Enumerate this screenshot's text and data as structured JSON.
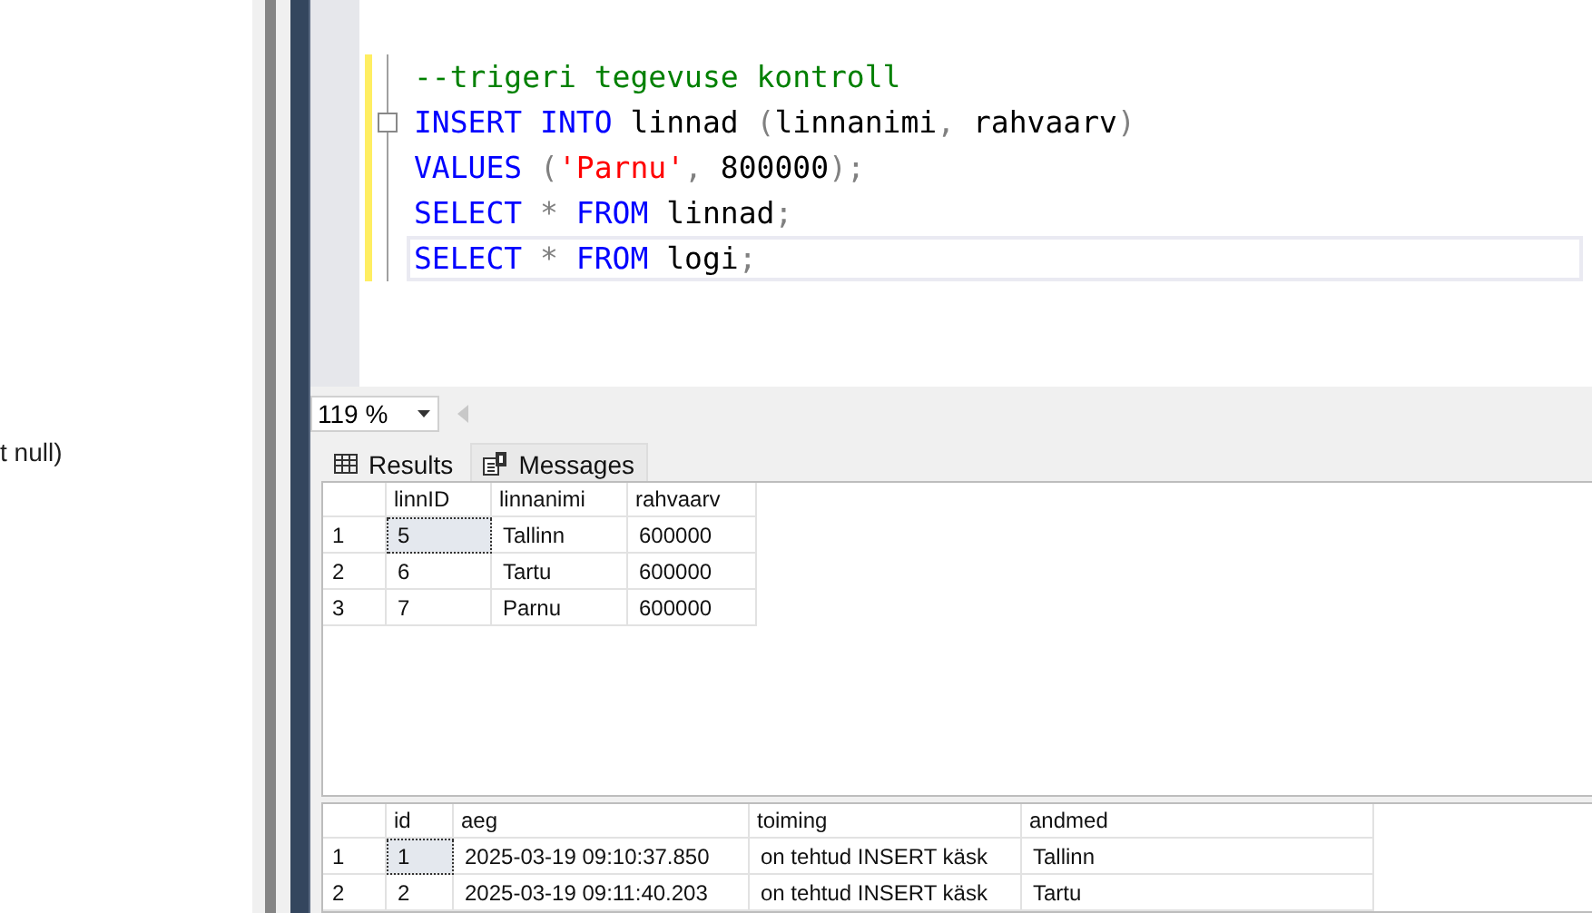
{
  "left_panel": {
    "text": "t null)"
  },
  "editor": {
    "lines": [
      {
        "collapsible": false,
        "current": false,
        "tokens": [
          {
            "kind": "comment",
            "text": "--trigeri tegevuse kontroll"
          }
        ]
      },
      {
        "collapsible": true,
        "current": false,
        "tokens": [
          {
            "kind": "keyword",
            "text": "INSERT"
          },
          {
            "kind": "keyword",
            "text": " INTO"
          },
          {
            "kind": "plain",
            "text": " linnad"
          },
          {
            "kind": "punct",
            "text": " ("
          },
          {
            "kind": "plain",
            "text": "linnanimi"
          },
          {
            "kind": "punct",
            "text": ","
          },
          {
            "kind": "plain",
            "text": " rahvaarv"
          },
          {
            "kind": "punct",
            "text": ")"
          }
        ]
      },
      {
        "collapsible": false,
        "current": false,
        "tokens": [
          {
            "kind": "keyword",
            "text": "VALUES"
          },
          {
            "kind": "punct",
            "text": " ("
          },
          {
            "kind": "string",
            "text": "'Parnu'"
          },
          {
            "kind": "punct",
            "text": ","
          },
          {
            "kind": "plain",
            "text": " 800000"
          },
          {
            "kind": "punct",
            "text": ");"
          }
        ]
      },
      {
        "collapsible": false,
        "current": false,
        "tokens": [
          {
            "kind": "keyword",
            "text": "SELECT"
          },
          {
            "kind": "punct",
            "text": " *"
          },
          {
            "kind": "keyword",
            "text": " FROM"
          },
          {
            "kind": "plain",
            "text": " linnad"
          },
          {
            "kind": "punct",
            "text": ";"
          }
        ]
      },
      {
        "collapsible": false,
        "current": true,
        "tokens": [
          {
            "kind": "keyword",
            "text": "SELECT"
          },
          {
            "kind": "punct",
            "text": " *"
          },
          {
            "kind": "keyword",
            "text": " FROM"
          },
          {
            "kind": "plain",
            "text": " logi"
          },
          {
            "kind": "punct",
            "text": ";"
          }
        ]
      }
    ]
  },
  "zoom": {
    "value": "119 %"
  },
  "tabs": [
    {
      "label": "Results",
      "selected": true,
      "kind": "grid"
    },
    {
      "label": "Messages",
      "selected": false,
      "kind": "messages"
    }
  ],
  "grids": [
    {
      "columns": [
        "linnID",
        "linnanimi",
        "rahvaarv"
      ],
      "rows": [
        {
          "number": "1",
          "focused": true,
          "cells": [
            "5",
            "Tallinn",
            "600000"
          ]
        },
        {
          "number": "2",
          "focused": false,
          "cells": [
            "6",
            "Tartu",
            "600000"
          ]
        },
        {
          "number": "3",
          "focused": false,
          "cells": [
            "7",
            "Parnu",
            "600000"
          ]
        }
      ]
    },
    {
      "columns": [
        "id",
        "aeg",
        "toiming",
        "andmed"
      ],
      "rows": [
        {
          "number": "1",
          "focused": true,
          "cells": [
            "1",
            "2025-03-19 09:10:37.850",
            "on tehtud INSERT käsk",
            "Tallinn"
          ]
        },
        {
          "number": "2",
          "focused": false,
          "cells": [
            "2",
            "2025-03-19 09:11:40.203",
            "on tehtud INSERT käsk",
            "Tartu"
          ]
        }
      ]
    }
  ]
}
